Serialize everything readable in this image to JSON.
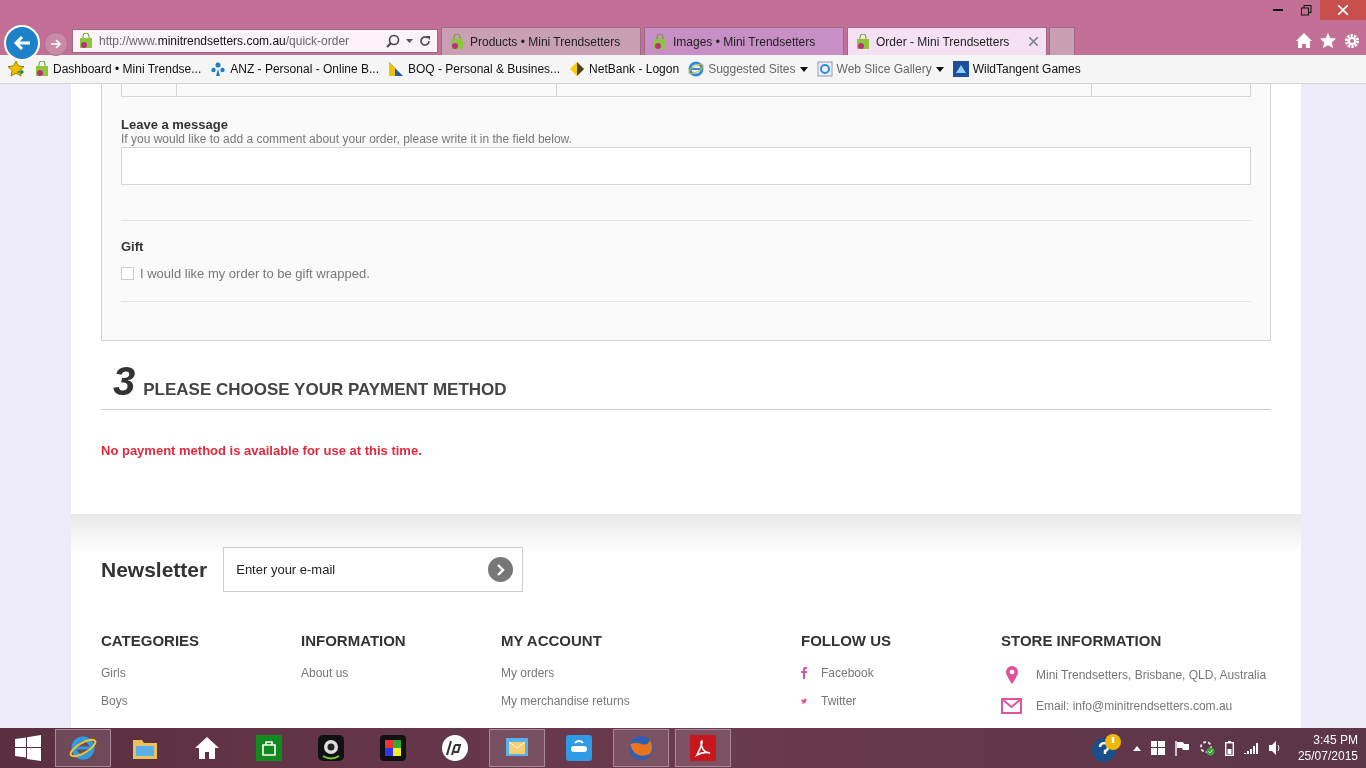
{
  "browser": {
    "address": "http://www.**minitrendsetters.com.au**/quick-order",
    "tabs": [
      {
        "title": "Products • Mini Trendsetters",
        "selected": false
      },
      {
        "title": "Images • Mini Trendsetters",
        "selected": false
      },
      {
        "title": "Order - Mini Trendsetters",
        "selected": true
      }
    ],
    "favorites": [
      {
        "label": "Dashboard • Mini Trendse...",
        "kind": "link"
      },
      {
        "label": "ANZ - Personal - Online B...",
        "kind": "link"
      },
      {
        "label": "BOQ - Personal & Busines...",
        "kind": "link"
      },
      {
        "label": "NetBank - Logon",
        "kind": "link"
      },
      {
        "label": "Suggested Sites",
        "kind": "dropdown"
      },
      {
        "label": "Web Slice Gallery",
        "kind": "dropdown"
      },
      {
        "label": "WildTangent Games",
        "kind": "link"
      }
    ]
  },
  "message": {
    "title": "Leave a message",
    "hint": "If you would like to add a comment about your order, please write it in the field below."
  },
  "gift": {
    "title": "Gift",
    "label": "I would like my order to be gift wrapped.",
    "checked": false
  },
  "payment_step": {
    "number": "3",
    "title": "PLEASE CHOOSE YOUR PAYMENT METHOD",
    "error": "No payment method is available for use at this time."
  },
  "newsletter": {
    "title": "Newsletter",
    "placeholder": "Enter your e-mail"
  },
  "footer_columns": [
    {
      "heading": "CATEGORIES",
      "kind": "plain",
      "links": [
        "Girls",
        "Boys"
      ]
    },
    {
      "heading": "INFORMATION",
      "kind": "plain",
      "links": [
        "About us"
      ]
    },
    {
      "heading": "MY ACCOUNT",
      "kind": "plain",
      "links": [
        "My orders",
        "My merchandise returns"
      ]
    },
    {
      "heading": "FOLLOW US",
      "kind": "social",
      "links": [
        "Facebook",
        "Twitter"
      ]
    },
    {
      "heading": "STORE INFORMATION",
      "kind": "contact",
      "links": [
        "Mini Trendsetters, Brisbane, QLD, Australia",
        "Email: info@minitrendsetters.com.au"
      ]
    }
  ],
  "taskbar": {
    "apps": [
      {
        "open": true
      },
      {
        "open": false
      },
      {
        "open": false
      },
      {
        "open": false
      },
      {
        "open": false
      },
      {
        "open": false
      },
      {
        "open": false
      },
      {
        "open": true
      },
      {
        "open": false
      },
      {
        "open": true
      },
      {
        "open": true
      }
    ],
    "time": "3:45 PM",
    "date": "25/07/2015"
  }
}
